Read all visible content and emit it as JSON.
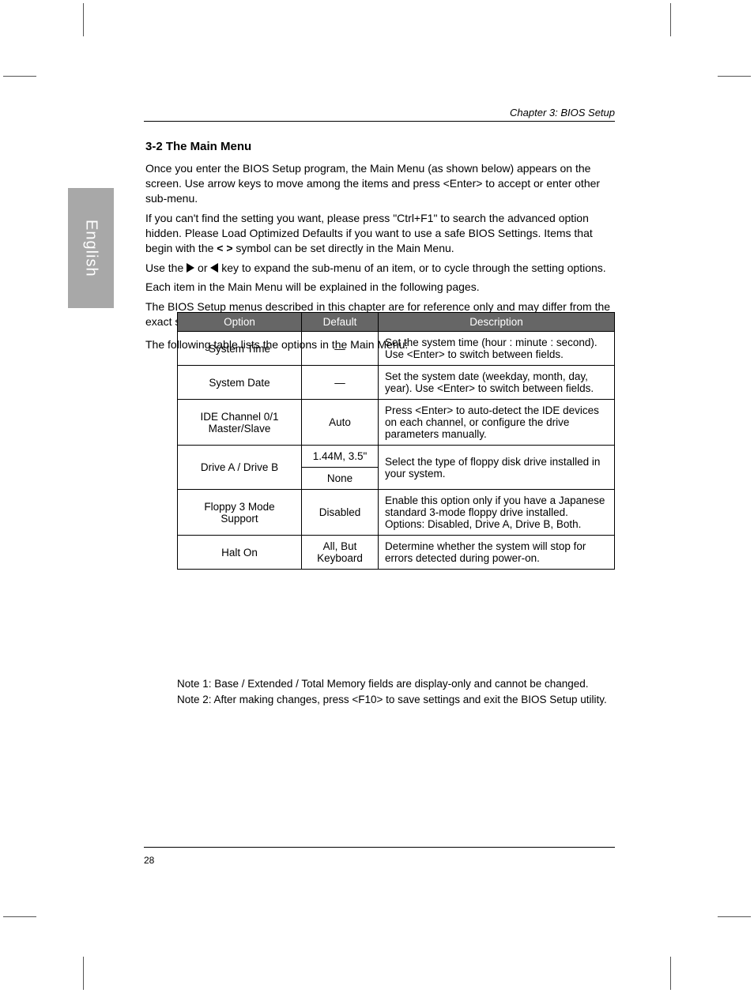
{
  "header": "Chapter 3: BIOS Setup",
  "language_tab": "English",
  "section_heading": "3-2 The Main Menu",
  "paragraphs": {
    "0": "Once you enter the BIOS Setup program, the Main Menu (as shown below) appears on the screen. Use arrow keys to move among the items and press <Enter> to accept or enter other sub-menu.",
    "1a": "If you can't find the setting you want, please press \"Ctrl+F1\" to search the advanced option hidden. Please Load Optimized Defaults if you want to use a safe BIOS Settings. Items that begin with the ",
    "1b": " symbol can be set directly in the Main Menu.",
    "2a": "Use the ",
    "2mid": " or ",
    "2b": " key to expand the sub-menu of an item, or to cycle through the setting options.",
    "3": "Each item in the Main Menu will be explained in the following pages.",
    "4": "The BIOS Setup menus described in this chapter are for reference only and may differ from the exact settings for your motherboard.",
    "5": "The following table lists the options in the Main Menu:"
  },
  "table": {
    "headers": [
      "Option",
      "Default",
      "Description"
    ],
    "rows": [
      {
        "option": "System Time",
        "def": "—",
        "desc": "Set the system time (hour : minute : second). Use <Enter> to switch between fields."
      },
      {
        "option": "System Date",
        "def": "—",
        "desc": "Set the system date (weekday, month, day, year). Use <Enter> to switch between fields."
      },
      {
        "option": "IDE Channel 0/1 Master/Slave",
        "def": "Auto",
        "desc": "Press <Enter> to auto-detect the IDE devices on each channel, or configure the drive parameters manually."
      },
      {
        "option": "Drive A / Drive B",
        "def": "1.44M, 3.5\"",
        "def2": "None",
        "desc": "Select the type of floppy disk drive installed in your system."
      },
      {
        "option": "Floppy 3 Mode Support",
        "def": "Disabled",
        "desc": "Enable this option only if you have a Japanese standard 3-mode floppy drive installed. Options: Disabled, Drive A, Drive B, Both."
      },
      {
        "option": "Halt On",
        "def": "All, But Keyboard",
        "desc": "Determine whether the system will stop for errors detected during power-on."
      }
    ]
  },
  "footnotes": [
    "Note 1: Base / Extended / Total Memory fields are display-only and cannot be changed.",
    "Note 2: After making changes, press <F10> to save settings and exit the BIOS Setup utility."
  ],
  "page_number": "28"
}
